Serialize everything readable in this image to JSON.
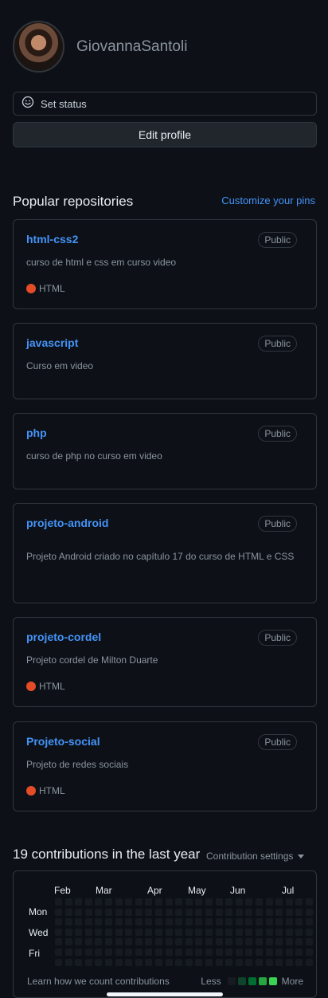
{
  "profile": {
    "username": "GiovannaSantoli"
  },
  "actions": {
    "set_status": "Set status",
    "edit_profile": "Edit profile"
  },
  "popular": {
    "title": "Popular repositories",
    "customize": "Customize your pins",
    "repos": [
      {
        "name": "html-css2",
        "visibility": "Public",
        "description": "curso de html e css em curso video",
        "language": "HTML"
      },
      {
        "name": "javascript",
        "visibility": "Public",
        "description": "Curso em video",
        "language": ""
      },
      {
        "name": "php",
        "visibility": "Public",
        "description": "curso de php no curso em video",
        "language": ""
      },
      {
        "name": "projeto-android",
        "visibility": "Public",
        "description": "Projeto Android criado no capítulo 17 do curso de HTML e CSS",
        "language": ""
      },
      {
        "name": "projeto-cordel",
        "visibility": "Public",
        "description": "Projeto cordel de Milton Duarte",
        "language": "HTML"
      },
      {
        "name": "Projeto-social",
        "visibility": "Public",
        "description": "Projeto de redes sociais",
        "language": "HTML"
      }
    ],
    "language_color": "#e34c26"
  },
  "contributions": {
    "title": "19 contributions in the last year",
    "settings_label": "Contribution settings",
    "months": [
      "Feb",
      "Mar",
      "Apr",
      "May",
      "Jun",
      "Jul"
    ],
    "days": [
      "Mon",
      "Wed",
      "Fri"
    ],
    "learn": "Learn how we count contributions",
    "legend_less": "Less",
    "legend_more": "More",
    "legend_colors": [
      "#161b22",
      "#0e4429",
      "#006d32",
      "#26a641",
      "#39d353"
    ]
  }
}
